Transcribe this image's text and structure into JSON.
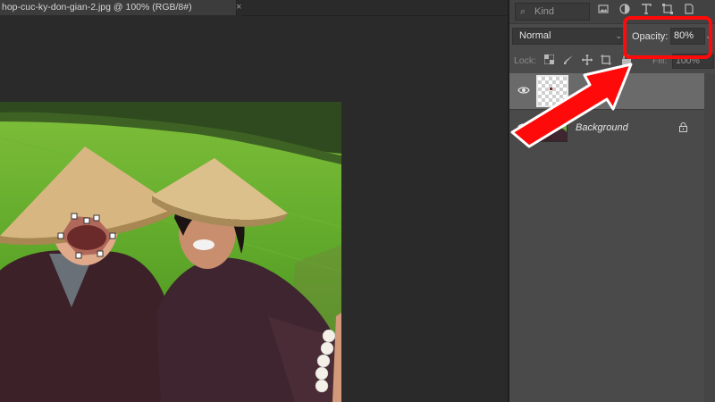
{
  "document": {
    "tab_title": "hop-cuc-ky-don-gian-2.jpg @ 100% (RGB/8#)",
    "close_glyph": "×"
  },
  "layers_panel": {
    "filter": {
      "mag_glyph": "⌕",
      "kind_placeholder": "Kind",
      "icons": [
        "image-filter-icon",
        "adjustment-filter-icon",
        "type-filter-icon",
        "shape-filter-icon",
        "smart-object-filter-icon"
      ]
    },
    "blend_mode": "Normal",
    "opacity_label": "Opacity:",
    "opacity_value": "80%",
    "lock_label": "Lock:",
    "lock_icons": [
      "lock-transparent-pixels-icon",
      "lock-image-pixels-icon",
      "lock-position-icon",
      "lock-artboard-icon",
      "lock-all-icon"
    ],
    "fill_label": "Fill:",
    "fill_value": "100%",
    "layers": [
      {
        "name": "",
        "thumbnail": "transparent",
        "visible": true,
        "selected": true
      },
      {
        "name": "Background",
        "thumbnail": "photo",
        "visible": true,
        "locked": true,
        "lock_glyph": "🔒"
      }
    ]
  },
  "annotation": {
    "highlight_color": "#ff0a0a",
    "arrow_color": "#ff0a0a"
  }
}
